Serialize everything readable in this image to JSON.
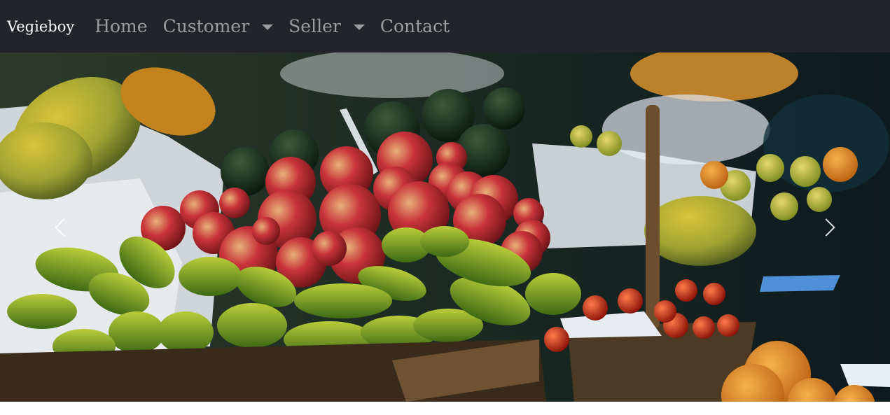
{
  "navbar": {
    "brand": "Vegieboy",
    "items": [
      {
        "label": "Home",
        "dropdown": false
      },
      {
        "label": "Customer",
        "dropdown": true
      },
      {
        "label": "Seller",
        "dropdown": true
      },
      {
        "label": "Contact",
        "dropdown": false
      }
    ]
  },
  "carousel": {
    "controls": {
      "prev_icon": "chevron-left-icon",
      "next_icon": "chevron-right-icon"
    }
  },
  "colors": {
    "navbar_bg": "#212529",
    "brand_text": "#ffffff",
    "nav_text": "rgba(255,255,255,0.55)"
  }
}
